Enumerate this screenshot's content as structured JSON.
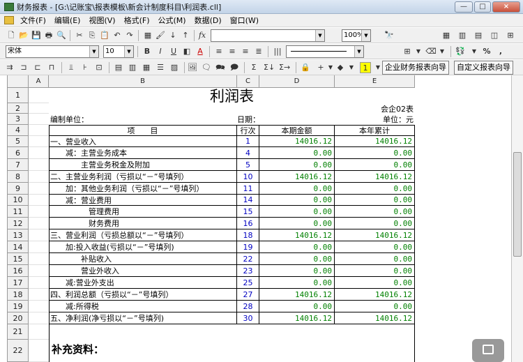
{
  "window": {
    "title": "财务报表 - [G:\\记账宝\\报表模板\\新会计制度科目\\利润表.cll]",
    "min": "—",
    "max": "□",
    "close": "×"
  },
  "menu": [
    "文件(F)",
    "编辑(E)",
    "视图(V)",
    "格式(F)",
    "公式(M)",
    "数据(D)",
    "窗口(W)"
  ],
  "toolbar": {
    "zoom": "100%",
    "font_name": "宋体",
    "font_size": "10",
    "fx": "fx",
    "report_wizard_btn": "企业财务报表向导",
    "custom_wizard_btn": "自定义报表向导"
  },
  "sheet": {
    "columns": [
      "A",
      "B",
      "C",
      "D",
      "E"
    ],
    "rows": [
      "1",
      "2",
      "3",
      "4",
      "5",
      "6",
      "7",
      "8",
      "9",
      "10",
      "11",
      "12",
      "13",
      "14",
      "15",
      "16",
      "17",
      "18",
      "19",
      "20",
      "21",
      "22"
    ],
    "title": "利润表",
    "form_code": "会企02表",
    "prepared_by": "编制单位：",
    "date_label": "日期：",
    "unit_label": "单位：元",
    "header": {
      "item": "项　　目",
      "line_no": "行次",
      "current": "本期金额",
      "ytd": "本年累计"
    },
    "body": [
      {
        "item": "一、营业收入",
        "no": "1",
        "cur": "14016.12",
        "ytd": "14016.12"
      },
      {
        "item": "　　减：主营业务成本",
        "no": "4",
        "cur": "0.00",
        "ytd": "0.00"
      },
      {
        "item": "　　　　主营业务税金及附加",
        "no": "5",
        "cur": "0.00",
        "ytd": "0.00"
      },
      {
        "item": "二、主营业务利润（亏损以“－”号填列）",
        "no": "10",
        "cur": "14016.12",
        "ytd": "14016.12"
      },
      {
        "item": "　　加：其他业务利润（亏损以“－”号填列）",
        "no": "11",
        "cur": "0.00",
        "ytd": "0.00"
      },
      {
        "item": "　　减：营业费用",
        "no": "14",
        "cur": "0.00",
        "ytd": "0.00"
      },
      {
        "item": "　　　　　管理费用",
        "no": "15",
        "cur": "0.00",
        "ytd": "0.00"
      },
      {
        "item": "　　　　　财务费用",
        "no": "16",
        "cur": "0.00",
        "ytd": "0.00"
      },
      {
        "item": "三、营业利润（亏损总额以“－”号填列）",
        "no": "18",
        "cur": "14016.12",
        "ytd": "14016.12"
      },
      {
        "item": "　　加:投入收益(亏损以“－”号填列)",
        "no": "19",
        "cur": "0.00",
        "ytd": "0.00"
      },
      {
        "item": "　　　　补贴收入",
        "no": "22",
        "cur": "0.00",
        "ytd": "0.00"
      },
      {
        "item": "　　　　营业外收入",
        "no": "23",
        "cur": "0.00",
        "ytd": "0.00"
      },
      {
        "item": "　　减:营业外支出",
        "no": "25",
        "cur": "0.00",
        "ytd": "0.00"
      },
      {
        "item": "四、利润总额（亏损以“－”号填列）",
        "no": "27",
        "cur": "14016.12",
        "ytd": "14016.12"
      },
      {
        "item": "　　减:所得税",
        "no": "28",
        "cur": "0.00",
        "ytd": "0.00"
      },
      {
        "item": "五、净利润(净亏损以“－”号填列)",
        "no": "30",
        "cur": "14016.12",
        "ytd": "14016.12"
      }
    ],
    "supplement": "补充资料："
  }
}
